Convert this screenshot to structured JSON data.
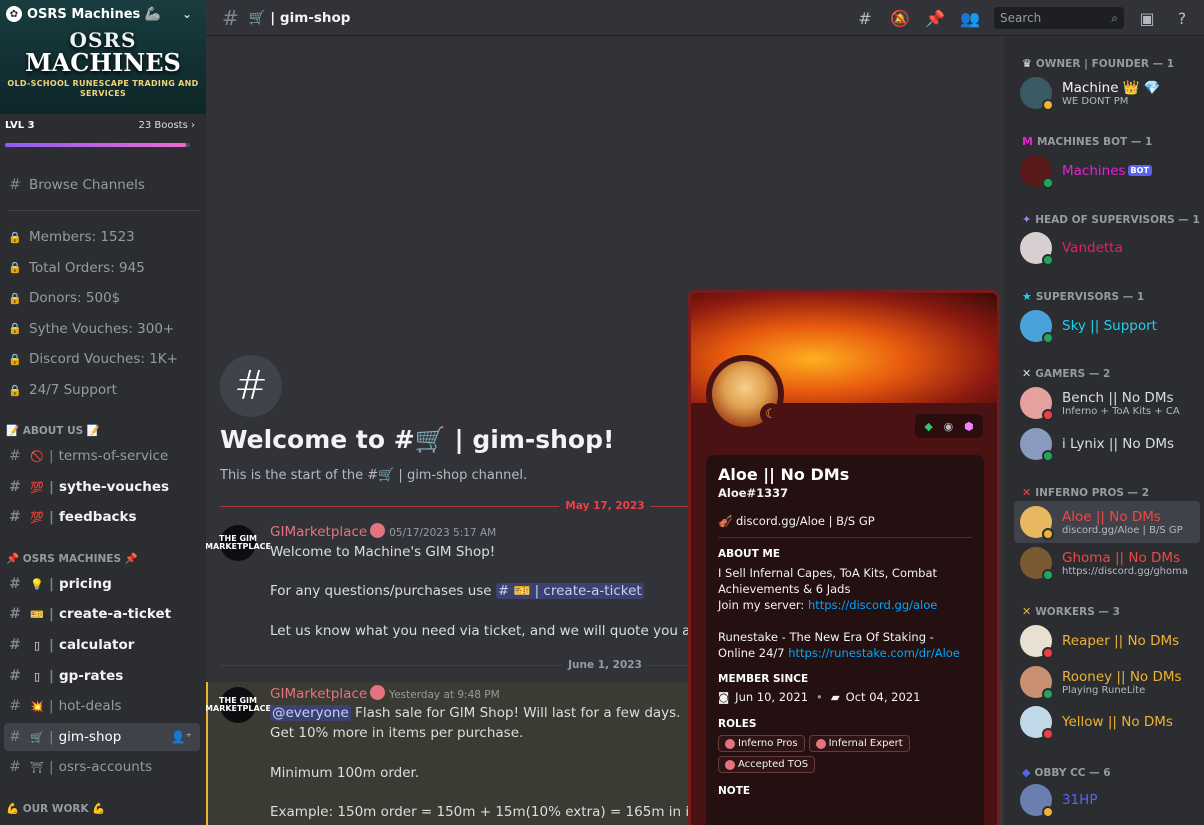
{
  "server": {
    "name": "OSRS Machines 🦾",
    "banner_line1": "OSRS",
    "banner_line2": "MACHINES",
    "banner_tagline": "OLD-SCHOOL RUNESCAPE TRADING AND SERVICES",
    "level": "LVL 3",
    "boosts": "23 Boosts ›",
    "boost_progress": 0.98
  },
  "sidebar": {
    "browse": "Browse Channels",
    "stats": [
      "Members: 1523",
      "Total Orders: 945",
      "Donors: 500$",
      "Sythe Vouches: 300+",
      "Discord Vouches: 1K+",
      "24/7 Support"
    ],
    "cat_about": "📝 ABOUT US 📝",
    "about": [
      {
        "emoji": "🚫",
        "name": "terms-of-service"
      },
      {
        "emoji": "💯",
        "name": "sythe-vouches"
      },
      {
        "emoji": "💯",
        "name": "feedbacks"
      }
    ],
    "cat_machines": "📌 OSRS MACHINES 📌",
    "machines": [
      {
        "emoji": "💡",
        "name": "pricing"
      },
      {
        "emoji": "🎫",
        "name": "create-a-ticket"
      },
      {
        "emoji": "▯",
        "name": "calculator"
      },
      {
        "emoji": "▯",
        "name": "gp-rates"
      },
      {
        "emoji": "💥",
        "name": "hot-deals"
      },
      {
        "emoji": "🛒",
        "name": "gim-shop"
      },
      {
        "emoji": "⛩",
        "name": "osrs-accounts"
      }
    ],
    "cat_work": "💪 OUR WORK 💪"
  },
  "topbar": {
    "channel": "🛒 | gim-shop",
    "search_placeholder": "Search"
  },
  "chat": {
    "welcome_title": "Welcome to #🛒 | gim-shop!",
    "welcome_sub": "This is the start of the #🛒 | gim-shop channel.",
    "date1": "May 17, 2023",
    "date2": "June 1, 2023",
    "msg1": {
      "avatar": "THE GIM MARKETPLACE",
      "author": "GIMarketplace",
      "time": "05/17/2023 5:17 AM",
      "line1": "Welcome to Machine's GIM Shop!",
      "line2_pre": "For any questions/purchases use",
      "line2_chip": "# 🎫 | create-a-ticket",
      "line3": "Let us know what you need via ticket, and we will quote you a price +"
    },
    "msg2": {
      "avatar": "THE GIM MARKETPLACE",
      "author": "GIMarketplace",
      "time": "Yesterday at 9:48 PM",
      "mention": "@everyone",
      "line1_rest": " Flash sale for GIM Shop! Will last for a few days.",
      "line2": "Get 10% more in items per purchase.",
      "line3": "Minimum 100m order.",
      "line4": "Example: 150m order = 150m + 15m(10% extra) = 165m in items"
    }
  },
  "members": {
    "categories": [
      "OWNER | FOUNDER — 1",
      "MACHINES BOT — 1",
      "HEAD OF SUPERVISORS — 1",
      "SUPERVISORS — 1",
      "GAMERS — 2",
      "INFERNO PROS — 2",
      "WORKERS — 3",
      "OBBY CC — 6"
    ],
    "list": [
      {
        "name": "Machine 👑 💎",
        "sub": "WE DONT PM"
      },
      {
        "name": "Machines",
        "badge": "BOT"
      },
      {
        "name": "Vandetta"
      },
      {
        "name": "Sky || Support"
      },
      {
        "name": "Bench || No DMs",
        "sub": "Inferno + ToA Kits + CA"
      },
      {
        "name": "i Lynix || No DMs"
      },
      {
        "name": "Aloe || No DMs",
        "sub": "discord.gg/Aloe | B/S GP"
      },
      {
        "name": "Ghoma || No DMs",
        "sub": "https://discord.gg/ghoma"
      },
      {
        "name": "Reaper || No DMs"
      },
      {
        "name": "Rooney || No DMs",
        "sub": "Playing RuneLite"
      },
      {
        "name": "Yellow || No DMs"
      },
      {
        "name": "31HP"
      }
    ]
  },
  "profile": {
    "name": "Aloe || No DMs",
    "tag": "Aloe#1337",
    "custom_status": "🎻 discord.gg/Aloe | B/S GP",
    "about_h": "ABOUT ME",
    "about_1": "I Sell Infernal Capes, ToA Kits, Combat Achievements & 6 Jads",
    "about_2_pre": "Join my server: ",
    "about_2_link": "https://discord.gg/aloe",
    "about_3": "Runestake - The New Era Of Staking - Online 24/7 ",
    "about_3_link": "https://runestake.com/dr/Aloe",
    "since_h": "MEMBER SINCE",
    "since_discord": "Jun 10, 2021",
    "since_server": "Oct 04, 2021",
    "roles_h": "ROLES",
    "roles": [
      "Inferno Pros",
      "Infernal Expert",
      "Accepted TOS"
    ],
    "note_h": "NOTE"
  },
  "colors": {
    "owner": "#f2f3f5",
    "bot": "#e91ed6",
    "head": "#e91e63",
    "supervisor": "#1fd1f0",
    "gamer": "#dbdee1",
    "inferno": "#f04747",
    "worker": "#f0b232",
    "obby": "#5865f2"
  }
}
